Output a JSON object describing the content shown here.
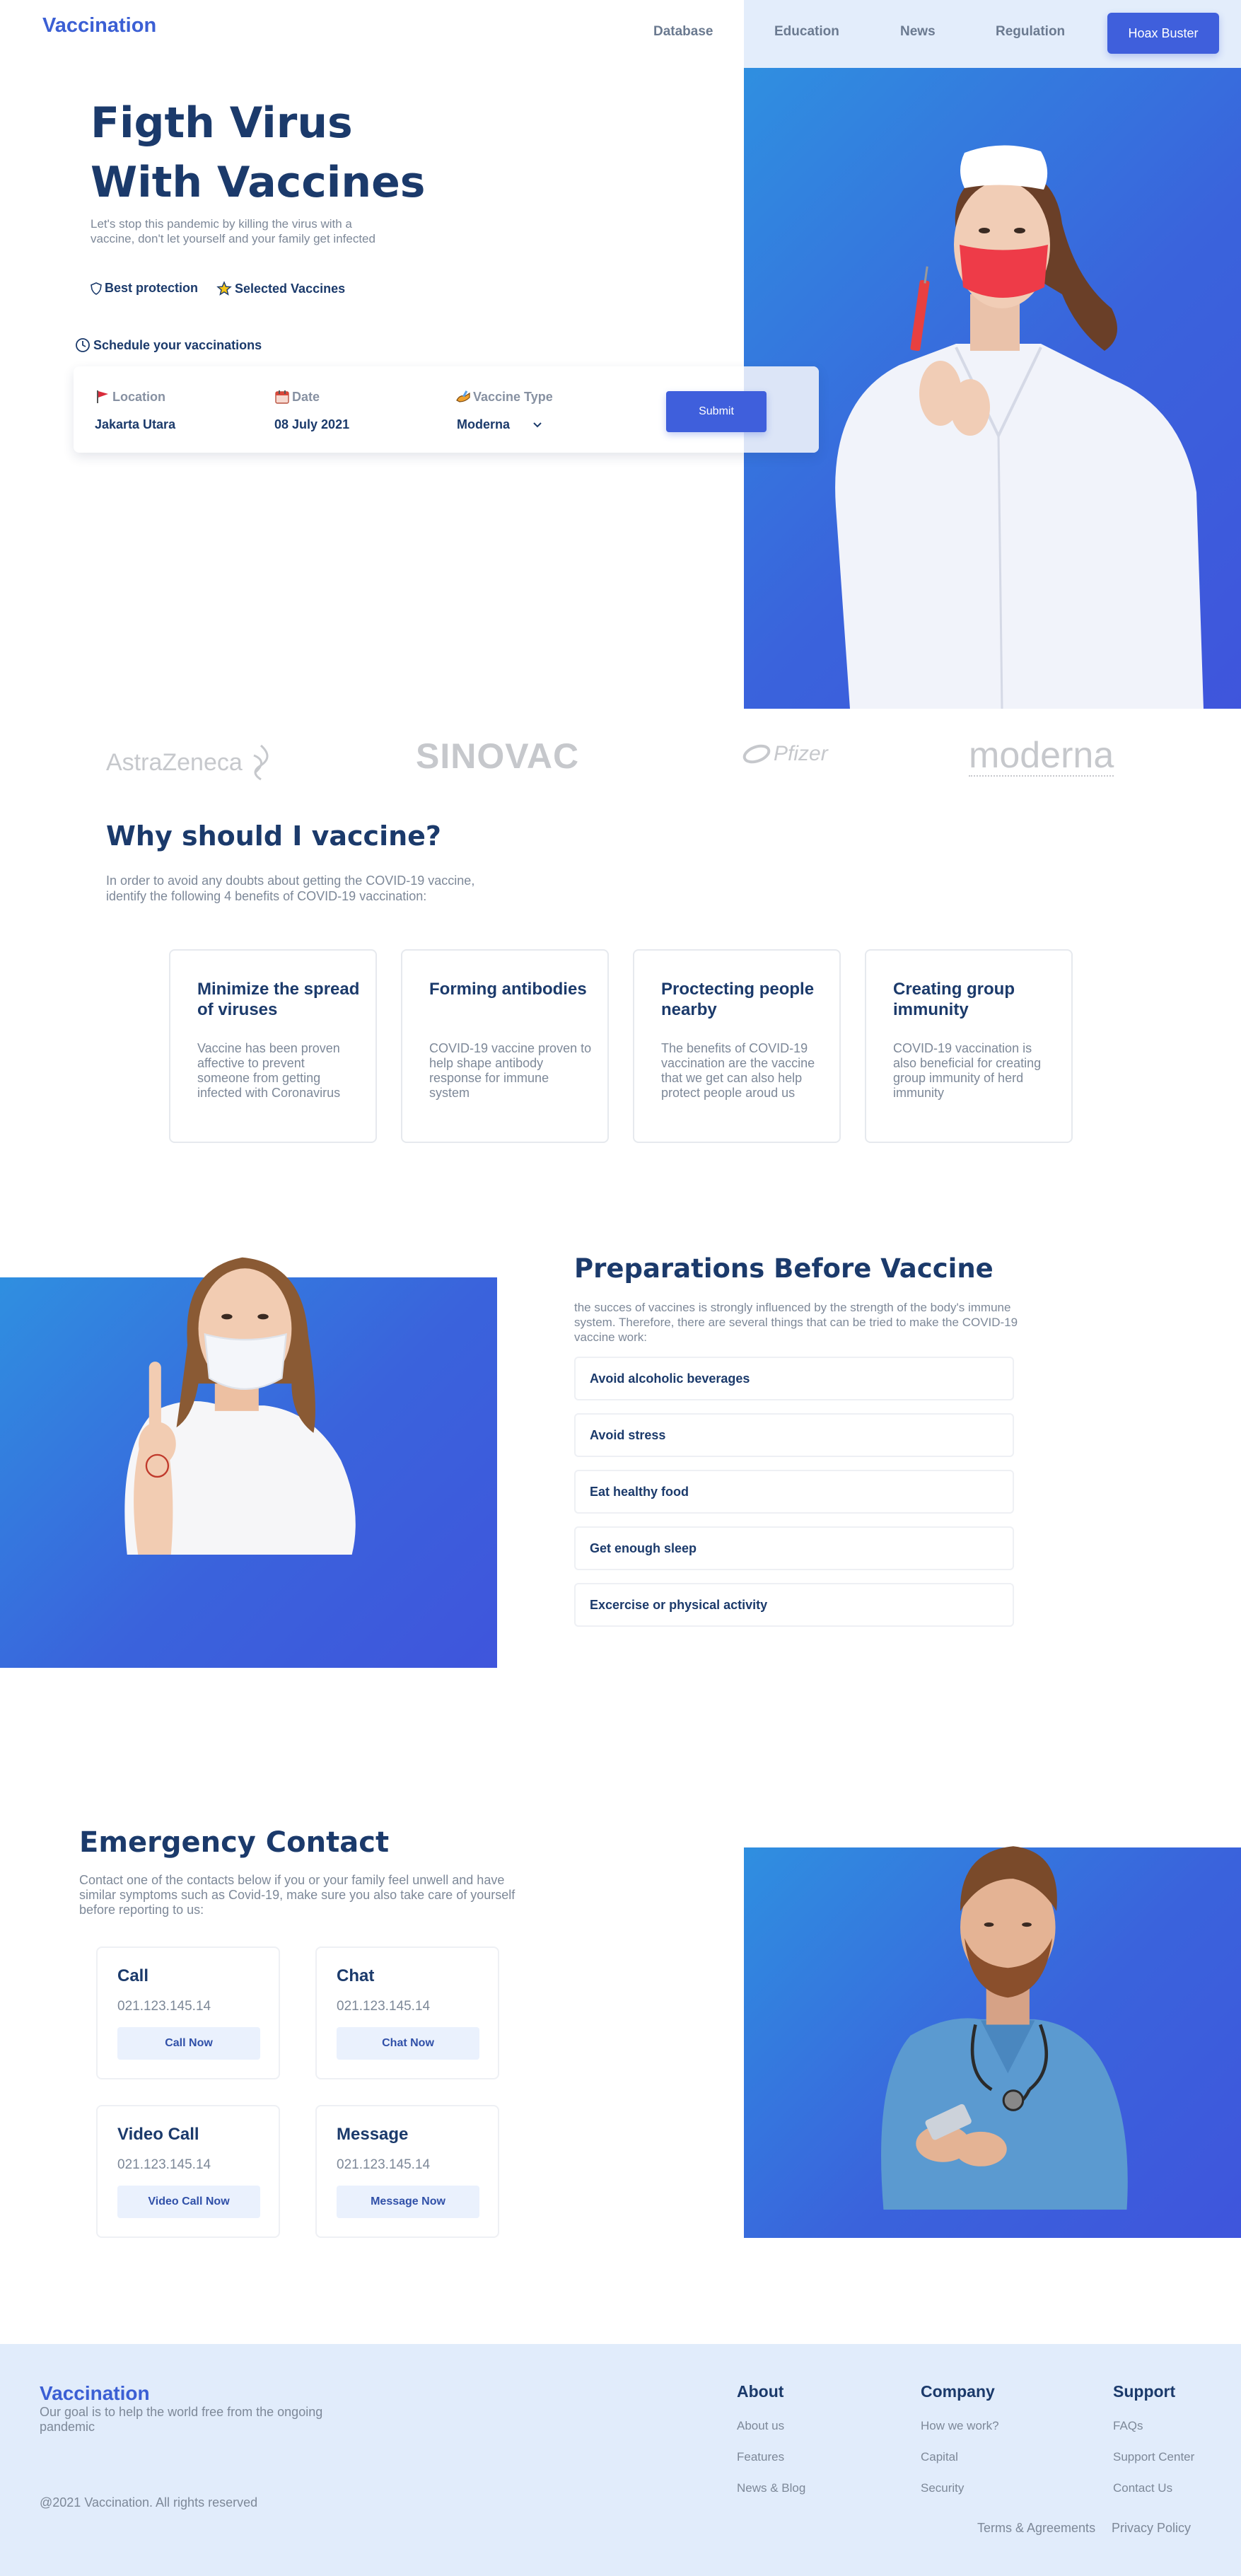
{
  "nav": {
    "brand": "Vaccination",
    "links": [
      "Database",
      "Education",
      "News",
      "Regulation"
    ],
    "cta": "Hoax Buster"
  },
  "hero": {
    "title_line1": "Figth Virus",
    "title_line2": "With Vaccines",
    "subtitle": "Let's stop this pandemic by killing the virus with a vaccine, don't let yourself and your family get infected",
    "features": [
      "Best protection",
      "Selected Vaccines"
    ],
    "schedule_label": "Schedule your vaccinations",
    "form": {
      "location_label": "Location",
      "location_value": "Jakarta Utara",
      "date_label": "Date",
      "date_value": "08 July 2021",
      "vaccine_label": "Vaccine Type",
      "vaccine_value": "Moderna",
      "submit": "Submit"
    }
  },
  "logos": [
    "AstraZeneca",
    "SINOVAC",
    "Pfizer",
    "moderna"
  ],
  "why": {
    "title": "Why should I vaccine?",
    "subtitle": "In order to avoid any doubts about getting the COVID-19 vaccine, identify the following 4 benefits of COVID-19 vaccination:",
    "cards": [
      {
        "title": "Minimize the spread of viruses",
        "text": "Vaccine has been proven affective to prevent someone from getting infected with Coronavirus"
      },
      {
        "title": "Forming antibodies",
        "text": "COVID-19 vaccine proven to help shape antibody response for immune system"
      },
      {
        "title": "Proctecting people nearby",
        "text": "The benefits of COVID-19 vaccination are the vaccine that we get can also help protect people aroud us"
      },
      {
        "title": "Creating group immunity",
        "text": "COVID-19 vaccination is also beneficial for creating group immunity of herd immunity"
      }
    ]
  },
  "prep": {
    "title": "Preparations Before Vaccine",
    "subtitle": "the succes of vaccines is strongly influenced by the strength of the body's immune system. Therefore, there are several things that can be tried to make the COVID-19 vaccine work:",
    "items": [
      "Avoid alcoholic beverages",
      "Avoid stress",
      "Eat healthy food",
      "Get enough sleep",
      "Excercise or physical activity"
    ]
  },
  "emergency": {
    "title": "Emergency Contact",
    "subtitle": "Contact one of the contacts below if you or your family feel unwell and have similar symptoms such as Covid-19, make sure you also take care of yourself before reporting to us:",
    "cards": [
      {
        "title": "Call",
        "number": "021.123.145.14",
        "button": "Call Now"
      },
      {
        "title": "Chat",
        "number": "021.123.145.14",
        "button": "Chat Now"
      },
      {
        "title": "Video Call",
        "number": "021.123.145.14",
        "button": "Video Call Now"
      },
      {
        "title": "Message",
        "number": "021.123.145.14",
        "button": "Message Now"
      }
    ]
  },
  "footer": {
    "brand": "Vaccination",
    "tagline": "Our goal is to help the world free from the ongoing pandemic",
    "copyright": "@2021 Vaccination. All rights reserved",
    "columns": [
      {
        "heading": "About",
        "links": [
          "About us",
          "Features",
          "News & Blog"
        ]
      },
      {
        "heading": "Company",
        "links": [
          "How we work?",
          "Capital",
          "Security"
        ]
      },
      {
        "heading": "Support",
        "links": [
          "FAQs",
          "Support Center",
          "Contact Us"
        ]
      }
    ],
    "bottom_links": [
      "Terms & Agreements",
      "Privacy Policy"
    ]
  },
  "colors": {
    "accent": "#3f5fdc",
    "brand": "#3b5fd4",
    "heading": "#1b3a6b",
    "muted": "#7d8898",
    "footer_bg": "#e1ecfb"
  }
}
